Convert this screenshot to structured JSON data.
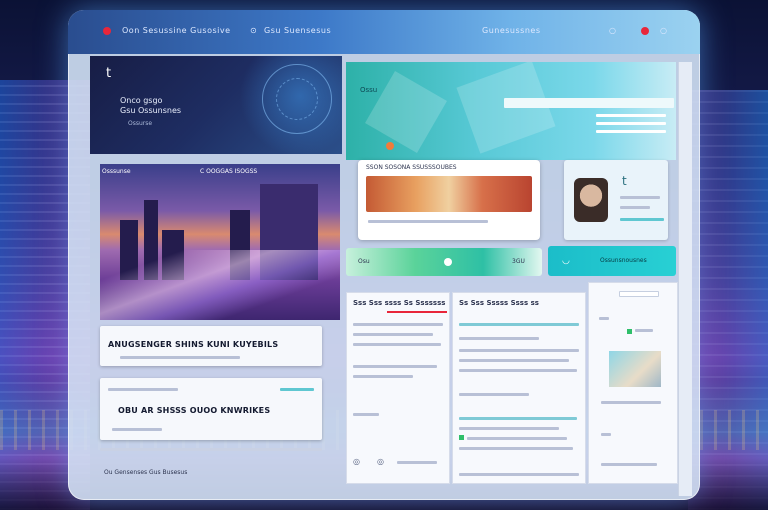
{
  "titlebar": {
    "left_text": "Oon Sesussine Gusosive",
    "center_text": "Gsu Suensesus",
    "right_text": "Gunesussnes"
  },
  "hero": {
    "logo_glyph": "t",
    "line1": "Onco gsgo",
    "line2": "Gsu Ossunsnes",
    "line3": "Ossurse"
  },
  "left_panel": {
    "card1_title": "ANUGSENGER SHINS KUNI KUYEBILS",
    "card2_title": "OBU AR SHSSS OUOO KNWRIKES",
    "city_caption_left": "Osssunse",
    "city_caption_right": "C OOGGAS ISOGSS",
    "footer_text": "Ou Gensenses Gus Busesus"
  },
  "middle": {
    "banner_label": "Ossu",
    "food_card_label": "SSON SOSONA SSUSSSOUBES",
    "section_left_heading": "Sss Sss ssss Ss Sssssss",
    "section_right_heading": "Ss Sss Sssss Ssss ss",
    "green_bar_value": "Osu",
    "green_bar_code": "3GU",
    "teal_bar_text": "Ossunsnousnes"
  },
  "profile": {
    "name_glyph": "t"
  },
  "colors": {
    "accent_red": "#e8263a",
    "accent_teal": "#1bbdc9",
    "accent_green": "#2fbf6a"
  },
  "icons": [
    "close-icon",
    "back-icon",
    "search-icon",
    "settings-icon",
    "share-icon",
    "play-icon"
  ]
}
